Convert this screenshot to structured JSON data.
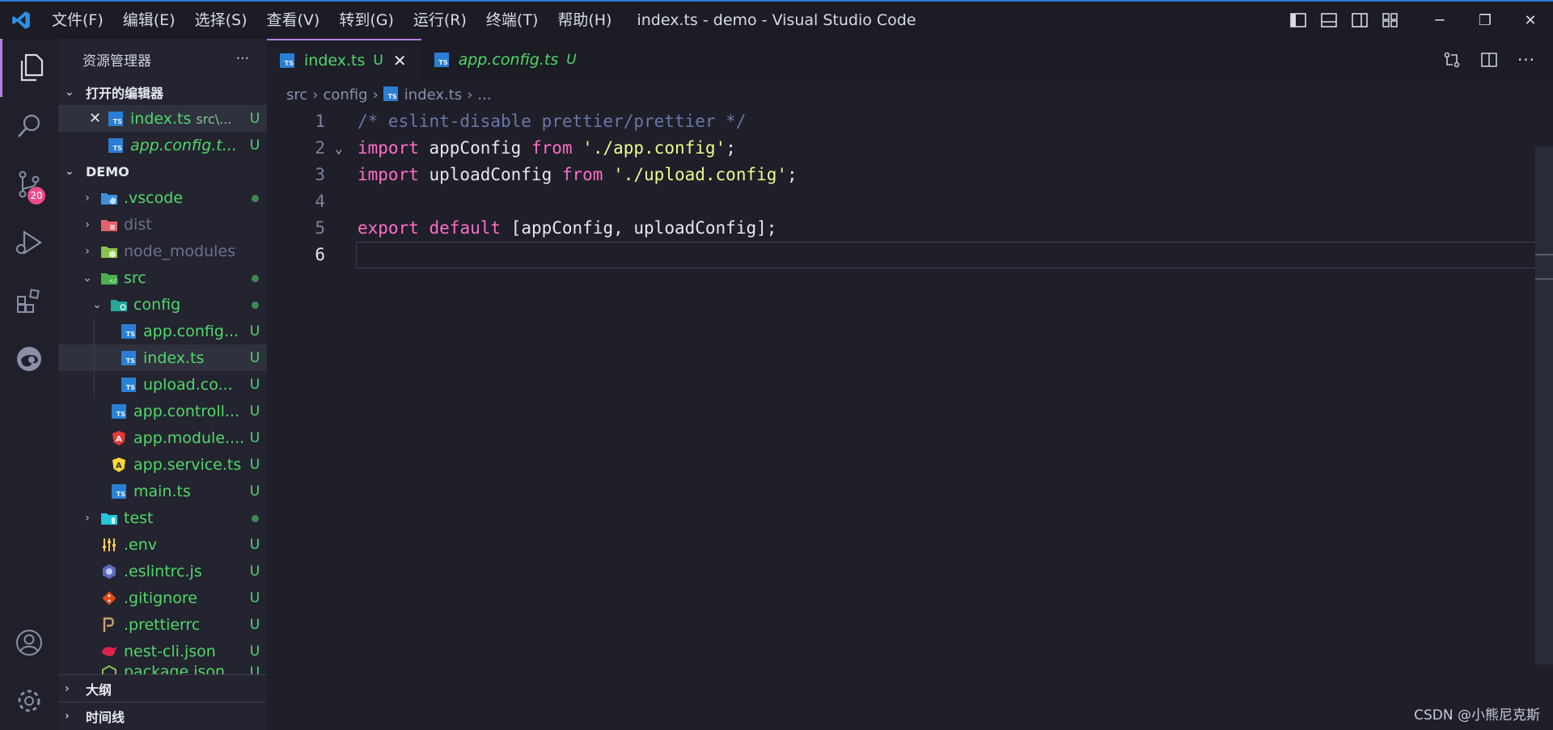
{
  "window": {
    "title": "index.ts - demo - Visual Studio Code",
    "menus": [
      "文件(F)",
      "编辑(E)",
      "选择(S)",
      "查看(V)",
      "转到(G)",
      "运行(R)",
      "终端(T)",
      "帮助(H)"
    ]
  },
  "activity_bar": {
    "scm_badge": "20"
  },
  "sidebar": {
    "title": "资源管理器",
    "more": "···",
    "open_editors_label": "打开的编辑器",
    "open_editors": [
      {
        "name": "index.ts",
        "path": "src\\...",
        "status": "U"
      },
      {
        "name": "app.config.t...",
        "status": "U"
      }
    ],
    "workspace_label": "DEMO",
    "tree": [
      {
        "name": ".vscode",
        "status": "●"
      },
      {
        "name": "dist",
        "status": ""
      },
      {
        "name": "node_modules",
        "status": ""
      },
      {
        "name": "src",
        "status": "●"
      },
      {
        "name": "config",
        "status": "●"
      },
      {
        "name": "app.config...",
        "status": "U"
      },
      {
        "name": "index.ts",
        "status": "U"
      },
      {
        "name": "upload.co...",
        "status": "U"
      },
      {
        "name": "app.controll...",
        "status": "U"
      },
      {
        "name": "app.module....",
        "status": "U"
      },
      {
        "name": "app.service.ts",
        "status": "U"
      },
      {
        "name": "main.ts",
        "status": "U"
      },
      {
        "name": "test",
        "status": "●"
      },
      {
        "name": ".env",
        "status": "U"
      },
      {
        "name": ".eslintrc.js",
        "status": "U"
      },
      {
        "name": ".gitignore",
        "status": "U"
      },
      {
        "name": ".prettierrc",
        "status": "U"
      },
      {
        "name": "nest-cli.json",
        "status": "U"
      },
      {
        "name": "package.json",
        "status": "U"
      }
    ],
    "outline_label": "大纲",
    "timeline_label": "时间线"
  },
  "tabs": [
    {
      "name": "index.ts",
      "status": "U",
      "active": true
    },
    {
      "name": "app.config.ts",
      "status": "U",
      "active": false
    }
  ],
  "breadcrumb": [
    "src",
    "config",
    "index.ts",
    "..."
  ],
  "code_lines": [
    {
      "n": "1",
      "parts": [
        {
          "c": "cmt",
          "t": "/* eslint-disable prettier/prettier */"
        }
      ]
    },
    {
      "n": "2",
      "parts": [
        {
          "c": "kw",
          "t": "import"
        },
        {
          "c": "",
          "t": " appConfig "
        },
        {
          "c": "kw",
          "t": "from"
        },
        {
          "c": "",
          "t": " "
        },
        {
          "c": "str",
          "t": "'./app.config'"
        },
        {
          "c": "",
          "t": ";"
        }
      ]
    },
    {
      "n": "3",
      "parts": [
        {
          "c": "kw",
          "t": "import"
        },
        {
          "c": "",
          "t": " uploadConfig "
        },
        {
          "c": "kw",
          "t": "from"
        },
        {
          "c": "",
          "t": " "
        },
        {
          "c": "str",
          "t": "'./upload.config'"
        },
        {
          "c": "",
          "t": ";"
        }
      ]
    },
    {
      "n": "4",
      "parts": []
    },
    {
      "n": "5",
      "parts": [
        {
          "c": "kw",
          "t": "export"
        },
        {
          "c": "",
          "t": " "
        },
        {
          "c": "kw",
          "t": "default"
        },
        {
          "c": "",
          "t": " [appConfig, uploadConfig];"
        }
      ]
    },
    {
      "n": "6",
      "parts": []
    }
  ],
  "watermark": "CSDN @小熊尼克斯",
  "colors": {
    "accent": "#b77ee0",
    "untracked": "#50d86a",
    "keyword": "#ff6ec7",
    "string": "#f1fa8c",
    "comment": "#6c75a8"
  }
}
